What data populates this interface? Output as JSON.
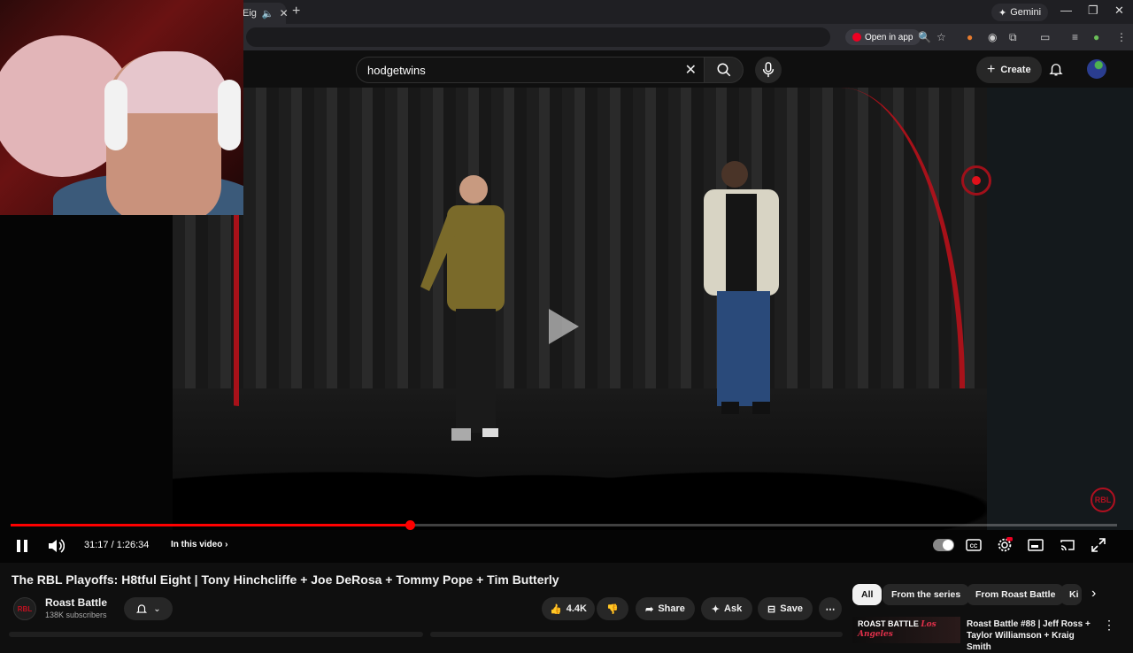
{
  "browser": {
    "tab_label": "Eig",
    "gemini_label": "Gemini",
    "open_in_app_label": "Open in app"
  },
  "youtube": {
    "search_value": "hodgetwins",
    "create_label": "Create"
  },
  "player": {
    "current_time": "31:17",
    "duration": "1:26:34",
    "time_display": "31:17 / 1:26:34",
    "progress_fraction": 0.361,
    "in_this_video_label": "In this video",
    "watermark": "RBL",
    "accent_color": "#ff0000"
  },
  "video": {
    "title": "The RBL Playoffs: H8tful Eight | Tony Hinchcliffe + Joe DeRosa + Tommy Pope + Tim Butterly",
    "channel_avatar": "RBL",
    "channel_name": "Roast Battle",
    "subscribers": "138K subscribers",
    "like_count": "4.4K",
    "share_label": "Share",
    "ask_label": "Ask",
    "save_label": "Save"
  },
  "chips": [
    "All",
    "From the series",
    "From Roast Battle",
    "Ki"
  ],
  "recommendation": {
    "thumb_text_1": "ROAST BATTLE",
    "thumb_text_2": "Los Angeles",
    "title": "Roast Battle #88 | Jeff Ross + Taylor Williamson + Kraig Smith"
  }
}
